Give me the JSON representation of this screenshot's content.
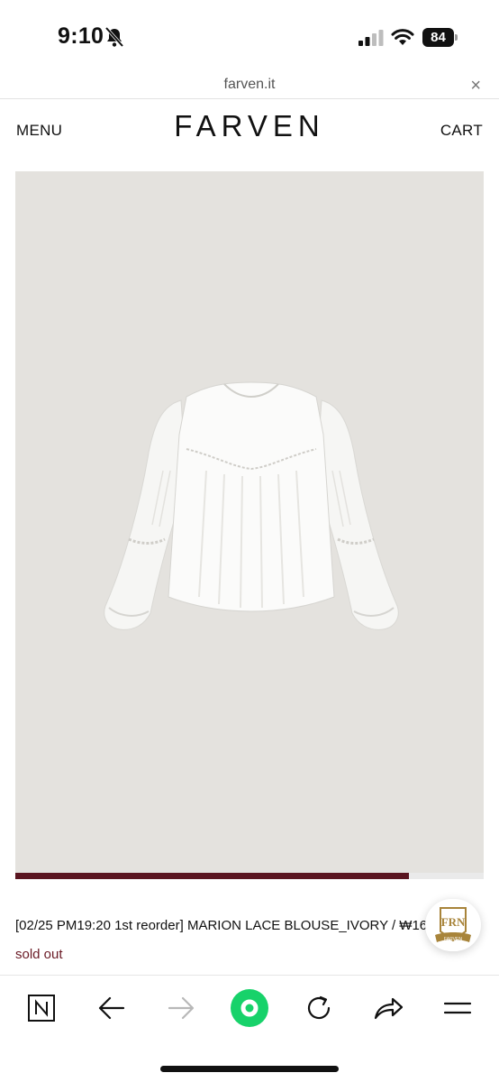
{
  "status_bar": {
    "time": "9:10",
    "battery": "84"
  },
  "browser": {
    "url": "farven.it",
    "close": "×"
  },
  "header": {
    "menu": "MENU",
    "brand": "FARVEN",
    "cart": "CART"
  },
  "product": {
    "title": "[02/25 PM19:20 1st reorder] MARION LACE BLOUSE_IVORY / ₩160",
    "status": "sold out",
    "gallery_progress": 0.84
  },
  "badge": {
    "text": "FRN",
    "sub": "FARVEN"
  },
  "toolbar": {
    "items": [
      "naver-home-icon",
      "back-arrow-icon",
      "forward-arrow-icon",
      "green-dot-icon",
      "reload-icon",
      "share-icon",
      "menu-icon"
    ]
  },
  "colors": {
    "accent": "#5a1520",
    "green": "#17d26a",
    "image_bg": "#e4e2de"
  }
}
